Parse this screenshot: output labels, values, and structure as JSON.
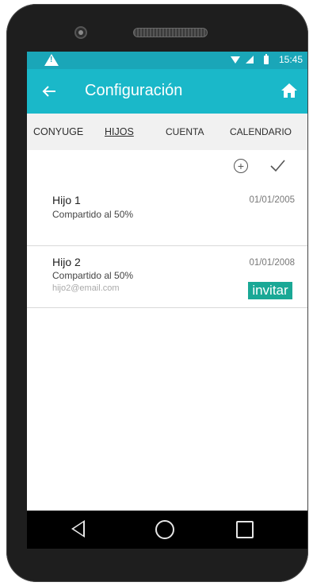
{
  "status_bar": {
    "time": "15:45",
    "icons": [
      "warning-icon",
      "wifi-icon",
      "signal-icon",
      "battery-icon"
    ]
  },
  "app_bar": {
    "title": "Configuración",
    "back_icon": "arrow-left-icon",
    "home_icon": "home-icon",
    "color": "#1ab8c9"
  },
  "tabs": [
    {
      "label": "CONYUGE",
      "active": false
    },
    {
      "label": "HIJOS",
      "active": true
    },
    {
      "label": "CUENTA",
      "active": false
    },
    {
      "label": "CALENDARIO",
      "active": false
    }
  ],
  "toolbar": {
    "add_icon": "add-circle-icon",
    "confirm_icon": "check-icon"
  },
  "children": [
    {
      "name": "Hijo 1",
      "share": "Compartido al 50%",
      "date": "01/01/2005"
    },
    {
      "name": "Hijo 2",
      "share": "Compartido al 50%",
      "date": "01/01/2008",
      "email": "hijo2@email.com",
      "invite_label": "invitar"
    }
  ],
  "colors": {
    "accent": "#1ab8c9",
    "invite": "#1aa896"
  }
}
